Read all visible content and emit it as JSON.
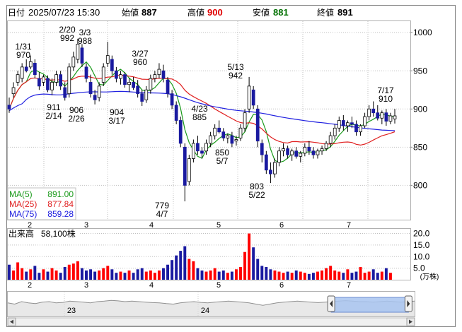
{
  "header": {
    "date_label": "日付",
    "date_value": "2025/07/23 15:30",
    "open_label": "始値",
    "open_value": "887",
    "high_label": "高値",
    "high_value": "900",
    "low_label": "安値",
    "low_value": "881",
    "close_label": "終値",
    "close_value": "891"
  },
  "colors": {
    "up_candle": "#ff0000",
    "down_candle": "#1a1aa0",
    "ma5": "#1a9a1a",
    "ma25": "#e02020",
    "ma75": "#2020e0",
    "grid": "#c0c0c0",
    "high_value": "#e00000",
    "low_value": "#007000"
  },
  "legend": [
    {
      "label": "MA(5)",
      "value": "891.00",
      "color": "#1a9a1a"
    },
    {
      "label": "MA(25)",
      "value": "877.84",
      "color": "#e02020"
    },
    {
      "label": "MA(75)",
      "value": "859.28",
      "color": "#2020e0"
    }
  ],
  "volume_label": "出来高",
  "volume_value": "58,100株",
  "volume_unit": "(万株)",
  "chart_data": {
    "type": "candlestick",
    "x_months": [
      "2",
      "3",
      "4",
      "5",
      "6",
      "7"
    ],
    "y_ticks": [
      800,
      850,
      900,
      950,
      1000
    ],
    "y_range": [
      755,
      1015
    ],
    "annotations": [
      {
        "date": "1/31",
        "value": "970",
        "kind": "high"
      },
      {
        "date": "2/20",
        "value": "992",
        "kind": "high"
      },
      {
        "date": "3/3",
        "value": "988",
        "kind": "high"
      },
      {
        "date": "2/14",
        "value": "911",
        "kind": "low"
      },
      {
        "date": "2/26",
        "value": "906",
        "kind": "low"
      },
      {
        "date": "3/17",
        "value": "904",
        "kind": "low"
      },
      {
        "date": "3/27",
        "value": "960",
        "kind": "high"
      },
      {
        "date": "4/7",
        "value": "779",
        "kind": "low"
      },
      {
        "date": "4/23",
        "value": "885",
        "kind": "high"
      },
      {
        "date": "5/7",
        "value": "850",
        "kind": "low"
      },
      {
        "date": "5/13",
        "value": "942",
        "kind": "high"
      },
      {
        "date": "5/22",
        "value": "803",
        "kind": "low"
      },
      {
        "date": "7/17",
        "value": "910",
        "kind": "high"
      }
    ],
    "volume_y_ticks": [
      "20.0",
      "15.0",
      "10.0",
      "5.0"
    ],
    "volume_range": [
      0,
      22
    ],
    "candles": [
      {
        "o": 905,
        "h": 915,
        "l": 895,
        "c": 900
      },
      {
        "o": 920,
        "h": 935,
        "l": 915,
        "c": 928
      },
      {
        "o": 935,
        "h": 950,
        "l": 930,
        "c": 945
      },
      {
        "o": 940,
        "h": 960,
        "l": 935,
        "c": 955
      },
      {
        "o": 955,
        "h": 965,
        "l": 948,
        "c": 950
      },
      {
        "o": 955,
        "h": 970,
        "l": 952,
        "c": 962
      },
      {
        "o": 960,
        "h": 965,
        "l": 940,
        "c": 945
      },
      {
        "o": 940,
        "h": 948,
        "l": 925,
        "c": 930
      },
      {
        "o": 935,
        "h": 945,
        "l": 930,
        "c": 942
      },
      {
        "o": 940,
        "h": 944,
        "l": 922,
        "c": 925
      },
      {
        "o": 925,
        "h": 940,
        "l": 918,
        "c": 935
      },
      {
        "o": 935,
        "h": 950,
        "l": 930,
        "c": 945
      },
      {
        "o": 945,
        "h": 950,
        "l": 925,
        "c": 930
      },
      {
        "o": 928,
        "h": 935,
        "l": 911,
        "c": 915
      },
      {
        "o": 920,
        "h": 960,
        "l": 915,
        "c": 955
      },
      {
        "o": 955,
        "h": 975,
        "l": 950,
        "c": 968
      },
      {
        "o": 965,
        "h": 992,
        "l": 960,
        "c": 985
      },
      {
        "o": 980,
        "h": 985,
        "l": 955,
        "c": 960
      },
      {
        "o": 955,
        "h": 960,
        "l": 935,
        "c": 940
      },
      {
        "o": 935,
        "h": 945,
        "l": 915,
        "c": 920
      },
      {
        "o": 918,
        "h": 925,
        "l": 906,
        "c": 912
      },
      {
        "o": 915,
        "h": 935,
        "l": 910,
        "c": 930
      },
      {
        "o": 935,
        "h": 960,
        "l": 930,
        "c": 955
      },
      {
        "o": 960,
        "h": 988,
        "l": 955,
        "c": 970
      },
      {
        "o": 965,
        "h": 970,
        "l": 945,
        "c": 950
      },
      {
        "o": 950,
        "h": 955,
        "l": 935,
        "c": 940
      },
      {
        "o": 940,
        "h": 950,
        "l": 932,
        "c": 945
      },
      {
        "o": 945,
        "h": 948,
        "l": 928,
        "c": 932
      },
      {
        "o": 932,
        "h": 940,
        "l": 922,
        "c": 935
      },
      {
        "o": 935,
        "h": 942,
        "l": 925,
        "c": 928
      },
      {
        "o": 930,
        "h": 938,
        "l": 915,
        "c": 920
      },
      {
        "o": 920,
        "h": 925,
        "l": 904,
        "c": 910
      },
      {
        "o": 912,
        "h": 930,
        "l": 908,
        "c": 925
      },
      {
        "o": 925,
        "h": 945,
        "l": 920,
        "c": 940
      },
      {
        "o": 940,
        "h": 950,
        "l": 935,
        "c": 945
      },
      {
        "o": 945,
        "h": 960,
        "l": 940,
        "c": 952
      },
      {
        "o": 950,
        "h": 958,
        "l": 935,
        "c": 940
      },
      {
        "o": 938,
        "h": 942,
        "l": 915,
        "c": 920
      },
      {
        "o": 920,
        "h": 925,
        "l": 900,
        "c": 905
      },
      {
        "o": 905,
        "h": 910,
        "l": 880,
        "c": 885
      },
      {
        "o": 885,
        "h": 890,
        "l": 850,
        "c": 855
      },
      {
        "o": 850,
        "h": 855,
        "l": 779,
        "c": 800
      },
      {
        "o": 805,
        "h": 840,
        "l": 800,
        "c": 835
      },
      {
        "o": 835,
        "h": 860,
        "l": 830,
        "c": 855
      },
      {
        "o": 855,
        "h": 865,
        "l": 840,
        "c": 845
      },
      {
        "o": 845,
        "h": 850,
        "l": 835,
        "c": 842
      },
      {
        "o": 845,
        "h": 860,
        "l": 840,
        "c": 855
      },
      {
        "o": 855,
        "h": 870,
        "l": 850,
        "c": 865
      },
      {
        "o": 865,
        "h": 880,
        "l": 860,
        "c": 875
      },
      {
        "o": 875,
        "h": 885,
        "l": 868,
        "c": 870
      },
      {
        "o": 870,
        "h": 875,
        "l": 858,
        "c": 862
      },
      {
        "o": 862,
        "h": 868,
        "l": 855,
        "c": 865
      },
      {
        "o": 865,
        "h": 870,
        "l": 850,
        "c": 855
      },
      {
        "o": 858,
        "h": 865,
        "l": 852,
        "c": 860
      },
      {
        "o": 862,
        "h": 880,
        "l": 858,
        "c": 875
      },
      {
        "o": 875,
        "h": 900,
        "l": 870,
        "c": 895
      },
      {
        "o": 900,
        "h": 942,
        "l": 895,
        "c": 930
      },
      {
        "o": 925,
        "h": 930,
        "l": 900,
        "c": 905
      },
      {
        "o": 900,
        "h": 905,
        "l": 850,
        "c": 858
      },
      {
        "o": 855,
        "h": 860,
        "l": 830,
        "c": 840
      },
      {
        "o": 840,
        "h": 845,
        "l": 815,
        "c": 820
      },
      {
        "o": 820,
        "h": 830,
        "l": 803,
        "c": 815
      },
      {
        "o": 815,
        "h": 835,
        "l": 810,
        "c": 830
      },
      {
        "o": 830,
        "h": 850,
        "l": 825,
        "c": 845
      },
      {
        "o": 845,
        "h": 855,
        "l": 838,
        "c": 848
      },
      {
        "o": 848,
        "h": 852,
        "l": 835,
        "c": 840
      },
      {
        "o": 840,
        "h": 848,
        "l": 832,
        "c": 845
      },
      {
        "o": 845,
        "h": 850,
        "l": 835,
        "c": 838
      },
      {
        "o": 838,
        "h": 845,
        "l": 830,
        "c": 842
      },
      {
        "o": 842,
        "h": 855,
        "l": 838,
        "c": 850
      },
      {
        "o": 850,
        "h": 858,
        "l": 840,
        "c": 845
      },
      {
        "o": 845,
        "h": 850,
        "l": 835,
        "c": 840
      },
      {
        "o": 840,
        "h": 848,
        "l": 835,
        "c": 845
      },
      {
        "o": 845,
        "h": 852,
        "l": 840,
        "c": 848
      },
      {
        "o": 848,
        "h": 858,
        "l": 845,
        "c": 855
      },
      {
        "o": 855,
        "h": 870,
        "l": 850,
        "c": 865
      },
      {
        "o": 865,
        "h": 880,
        "l": 860,
        "c": 875
      },
      {
        "o": 875,
        "h": 890,
        "l": 870,
        "c": 885
      },
      {
        "o": 885,
        "h": 892,
        "l": 872,
        "c": 878
      },
      {
        "o": 878,
        "h": 885,
        "l": 870,
        "c": 882
      },
      {
        "o": 882,
        "h": 890,
        "l": 875,
        "c": 880
      },
      {
        "o": 880,
        "h": 885,
        "l": 865,
        "c": 870
      },
      {
        "o": 870,
        "h": 880,
        "l": 865,
        "c": 878
      },
      {
        "o": 878,
        "h": 895,
        "l": 875,
        "c": 890
      },
      {
        "o": 890,
        "h": 905,
        "l": 885,
        "c": 900
      },
      {
        "o": 900,
        "h": 910,
        "l": 890,
        "c": 895
      },
      {
        "o": 895,
        "h": 905,
        "l": 885,
        "c": 888
      },
      {
        "o": 888,
        "h": 898,
        "l": 880,
        "c": 895
      },
      {
        "o": 895,
        "h": 900,
        "l": 878,
        "c": 884
      },
      {
        "o": 884,
        "h": 895,
        "l": 880,
        "c": 891
      },
      {
        "o": 887,
        "h": 900,
        "l": 881,
        "c": 891
      }
    ],
    "volumes": [
      6.5,
      4.0,
      7.5,
      5.0,
      3.5,
      4.5,
      6.0,
      3.0,
      4.5,
      3.5,
      5.0,
      4.0,
      3.0,
      5.5,
      6.5,
      7.0,
      8.0,
      5.0,
      4.0,
      4.5,
      3.5,
      4.0,
      5.0,
      6.0,
      4.5,
      3.0,
      3.5,
      3.0,
      4.0,
      3.0,
      4.5,
      5.0,
      3.5,
      4.0,
      3.0,
      4.0,
      5.0,
      6.5,
      8.5,
      10.5,
      12.5,
      14.5,
      9.0,
      8.0,
      5.0,
      4.0,
      3.5,
      4.0,
      5.0,
      3.5,
      4.0,
      3.0,
      3.5,
      4.5,
      5.5,
      12.0,
      20.0,
      14.0,
      9.0,
      6.0,
      5.5,
      4.5,
      4.0,
      3.5,
      3.0,
      3.5,
      3.0,
      4.0,
      3.5,
      3.0,
      2.5,
      3.0,
      3.5,
      4.0,
      5.0,
      6.0,
      4.0,
      3.5,
      3.0,
      4.5,
      3.0,
      3.5,
      5.5,
      3.0,
      3.5,
      4.5,
      3.0,
      3.5,
      5.0,
      3.0
    ]
  },
  "navigator": {
    "labels": [
      "23",
      "24"
    ],
    "selection": [
      0.795,
      0.985
    ],
    "trace": [
      0.55,
      0.5,
      0.6,
      0.55,
      0.52,
      0.58,
      0.6,
      0.55,
      0.57,
      0.62,
      0.6,
      0.58,
      0.55,
      0.6,
      0.62,
      0.65,
      0.63,
      0.6,
      0.62,
      0.6,
      0.58,
      0.56,
      0.55,
      0.52,
      0.5,
      0.55,
      0.58,
      0.6,
      0.57,
      0.55,
      0.58,
      0.6,
      0.62,
      0.6,
      0.58,
      0.55,
      0.5,
      0.45,
      0.5,
      0.55,
      0.58,
      0.6,
      0.62,
      0.6,
      0.58,
      0.56,
      0.58,
      0.6,
      0.62,
      0.64,
      0.62,
      0.6,
      0.6,
      0.58,
      0.6,
      0.62,
      0.6,
      0.58,
      0.6,
      0.62
    ]
  }
}
